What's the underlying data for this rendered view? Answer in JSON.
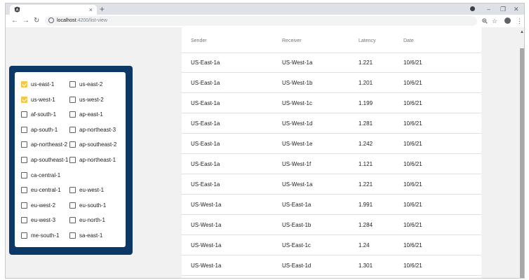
{
  "browser": {
    "tab_close": "×",
    "new_tab": "+",
    "url_host": "localhost",
    "url_path": ":4200/list-view",
    "win_min": "–",
    "win_max": "❐",
    "win_close": "✕"
  },
  "filters": {
    "items": [
      {
        "label": "us-east-1",
        "checked": true
      },
      {
        "label": "us-east-2",
        "checked": false
      },
      {
        "label": "us-west-1",
        "checked": true
      },
      {
        "label": "us-west-2",
        "checked": false
      },
      {
        "label": "af-south-1",
        "checked": false
      },
      {
        "label": "ap-east-1",
        "checked": false
      },
      {
        "label": "ap-south-1",
        "checked": false
      },
      {
        "label": "ap-northeast-3",
        "checked": false
      },
      {
        "label": "ap-northeast-2",
        "checked": false
      },
      {
        "label": "ap-southeast-2",
        "checked": false
      },
      {
        "label": "ap-southeast-1",
        "checked": false
      },
      {
        "label": "ap-northeast-1",
        "checked": false
      },
      {
        "label": "ca-central-1",
        "checked": false
      },
      {
        "label": "eu-central-1",
        "checked": false
      },
      {
        "label": "eu-west-1",
        "checked": false
      },
      {
        "label": "eu-west-2",
        "checked": false
      },
      {
        "label": "eu-south-1",
        "checked": false
      },
      {
        "label": "eu-west-3",
        "checked": false
      },
      {
        "label": "eu-north-1",
        "checked": false
      },
      {
        "label": "me-south-1",
        "checked": false
      },
      {
        "label": "sa-east-1",
        "checked": false
      }
    ]
  },
  "table": {
    "headers": [
      "Sender",
      "Receiver",
      "Latency",
      "Date"
    ],
    "rows": [
      [
        "US-East-1a",
        "US-West-1a",
        "1.221",
        "10/6/21"
      ],
      [
        "US-East-1a",
        "US-West-1b",
        "1.201",
        "10/6/21"
      ],
      [
        "US-East-1a",
        "US-West-1c",
        "1.199",
        "10/6/21"
      ],
      [
        "US-East-1a",
        "US-West-1d",
        "1.281",
        "10/6/21"
      ],
      [
        "US-East-1a",
        "US-West-1e",
        "1.242",
        "10/6/21"
      ],
      [
        "US-East-1a",
        "US-West-1f",
        "1.121",
        "10/6/21"
      ],
      [
        "US-East-1a",
        "US-West-1a",
        "1.221",
        "10/6/21"
      ],
      [
        "US-West-1a",
        "US-East-1a",
        "1.991",
        "10/6/21"
      ],
      [
        "US-West-1a",
        "US-East-1b",
        "1.284",
        "10/6/21"
      ],
      [
        "US-West-1a",
        "US-East-1c",
        "1.24",
        "10/6/21"
      ],
      [
        "US-West-1a",
        "US-East-1d",
        "1.301",
        "10/6/21"
      ]
    ]
  },
  "colors": {
    "panel": "#0c3868",
    "checkbox_checked": "#f4c842"
  }
}
